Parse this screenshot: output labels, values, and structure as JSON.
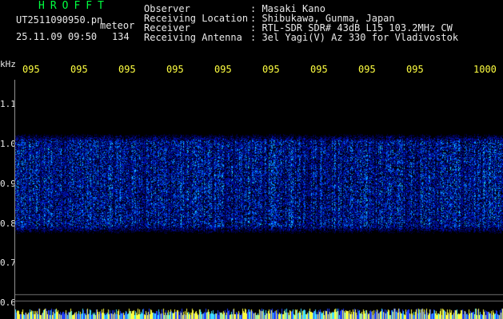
{
  "header": {
    "brand": "HROFFT",
    "filename": "UT2511090950.pn",
    "tag": "meteor",
    "datetime": "25.11.09 09:50",
    "count": "134"
  },
  "meta": [
    {
      "label": "Observer",
      "value": ": Masaki Kano"
    },
    {
      "label": "Receiving Location",
      "value": ": Shibukawa, Gunma, Japan"
    },
    {
      "label": "Receiver",
      "value": ": RTL-SDR SDR# 43dB L15 103.2MHz CW"
    },
    {
      "label": "Receiving Antenna",
      "value": ": 3el Yagi(V) Az 330 for Vladivostok"
    }
  ],
  "axis": {
    "unit": "kHz",
    "y_labels": [
      "1.1",
      "1.0",
      "0.9",
      "0.8",
      "0.7",
      "0.6"
    ],
    "time_ticks": [
      "095",
      "095",
      "095",
      "095",
      "095",
      "095",
      "095",
      "095",
      "095",
      "1000"
    ]
  },
  "colors": {
    "background": "#000000",
    "signal_dark": "#0010a0",
    "signal_mid": "#0050ff",
    "signal_hot": "#20e0ff",
    "text_white": "#e8e8e8",
    "text_green": "#00ff40",
    "text_yellow": "#ffff40"
  }
}
